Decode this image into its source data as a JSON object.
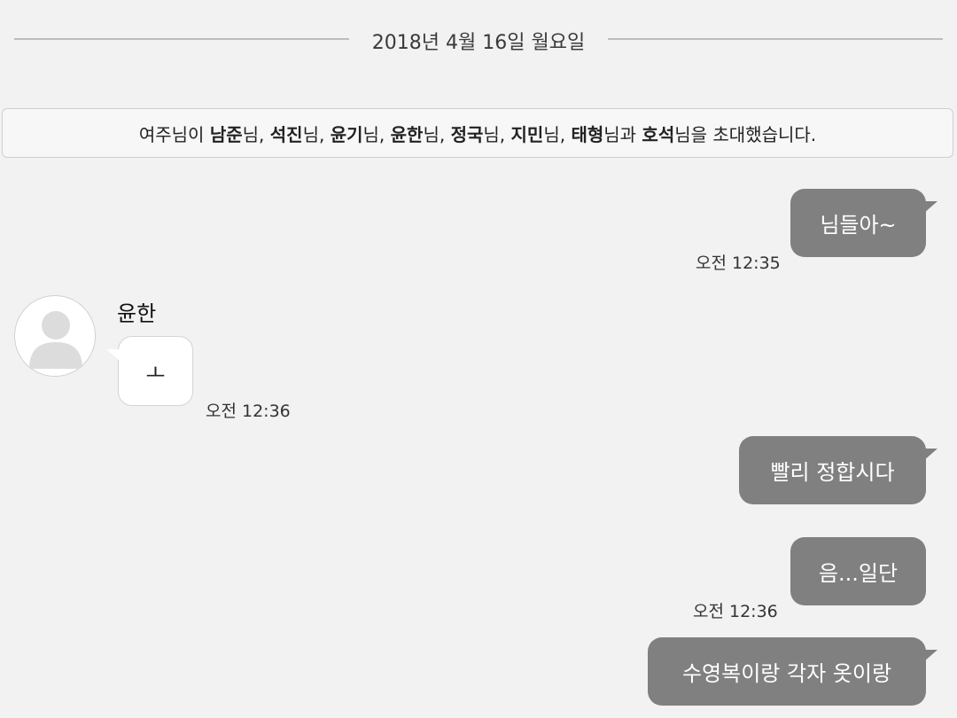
{
  "date_divider": "2018년 4월 16일 월요일",
  "notice": {
    "parts": [
      {
        "text": "여주님이 ",
        "bold": false
      },
      {
        "text": "남준",
        "bold": true
      },
      {
        "text": "님, ",
        "bold": false
      },
      {
        "text": "석진",
        "bold": true
      },
      {
        "text": "님, ",
        "bold": false
      },
      {
        "text": "윤기",
        "bold": true
      },
      {
        "text": "님, ",
        "bold": false
      },
      {
        "text": "윤한",
        "bold": true
      },
      {
        "text": "님, ",
        "bold": false
      },
      {
        "text": "정국",
        "bold": true
      },
      {
        "text": "님, ",
        "bold": false
      },
      {
        "text": "지민",
        "bold": true
      },
      {
        "text": "님, ",
        "bold": false
      },
      {
        "text": "태형",
        "bold": true
      },
      {
        "text": "님과 ",
        "bold": false
      },
      {
        "text": "호석",
        "bold": true
      },
      {
        "text": "님을 초대했습니다.",
        "bold": false
      }
    ]
  },
  "messages": [
    {
      "sender": "me",
      "text": "님들아~",
      "time": "오전 12:35"
    },
    {
      "sender": "윤한",
      "text": "ㅗ",
      "time": "오전 12:36"
    },
    {
      "sender": "me",
      "text": "빨리 정합시다",
      "time": ""
    },
    {
      "sender": "me",
      "text": "음...일단",
      "time": "오전 12:36"
    },
    {
      "sender": "me",
      "text": "수영복이랑 각자 옷이랑",
      "time": ""
    }
  ],
  "colors": {
    "background": "#f2f2f2",
    "my_bubble": "#808080",
    "their_bubble": "#ffffff"
  },
  "icons": {
    "avatar": "default-user-avatar"
  }
}
